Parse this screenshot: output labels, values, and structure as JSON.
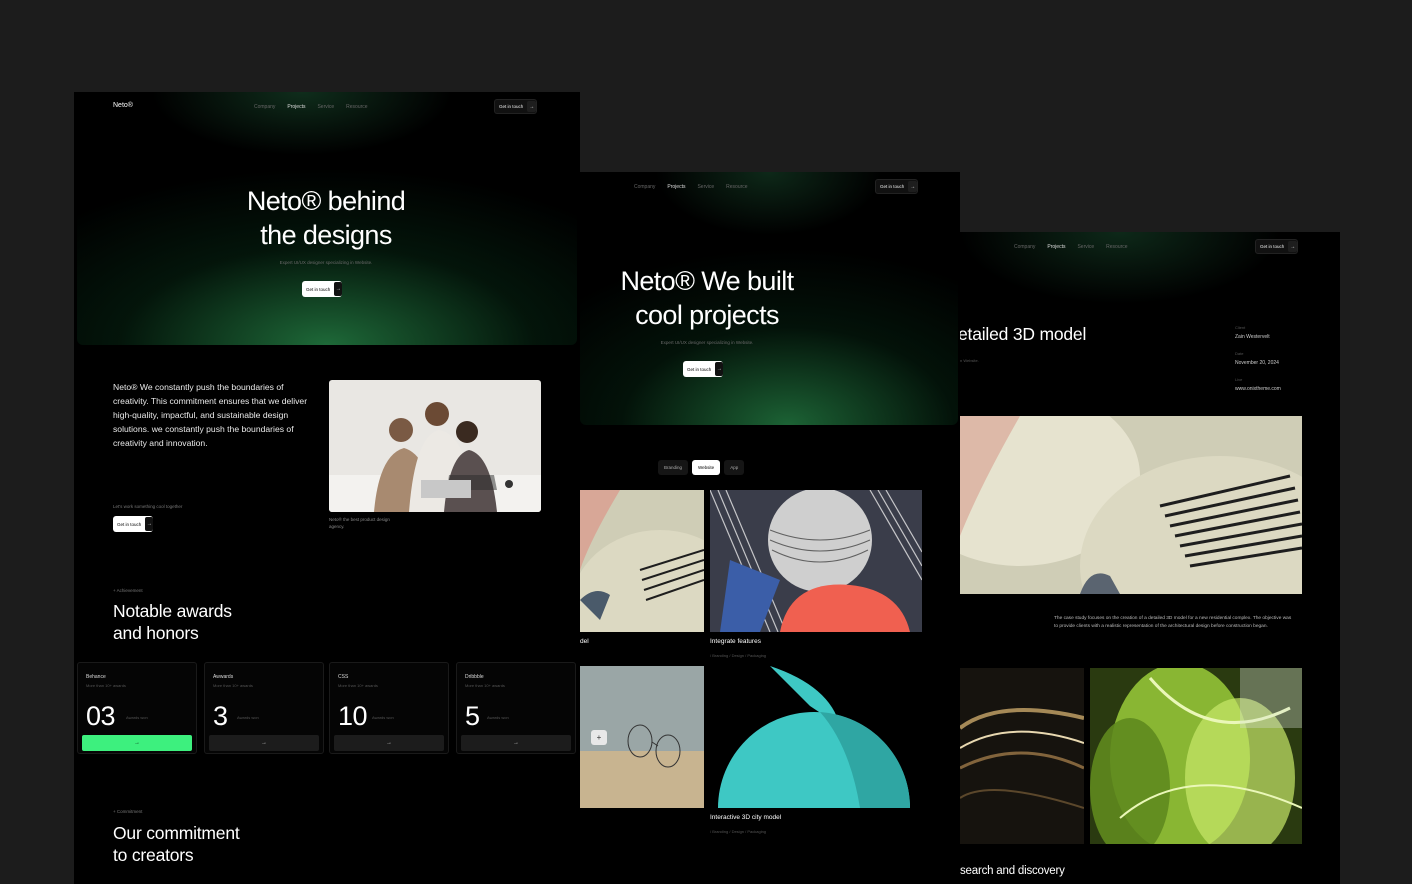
{
  "nav": {
    "company": "Company",
    "projects": "Projects",
    "service": "Service",
    "resource": "Resource",
    "cta": "Get in touch",
    "arrow": "→"
  },
  "panel1": {
    "brand": "Neto®",
    "hero_line1": "Neto® behind",
    "hero_line2": "the designs",
    "hero_sub": "Expert UI/UX designer specializing in Website.",
    "hero_btn": "Get in touch",
    "about": "Neto® We constantly push the boundaries of creativity. This commitment ensures that we deliver high-quality, impactful, and sustainable design solutions. we constantly push the boundaries of creativity and innovation.",
    "lets_work": "Let's work something cool together",
    "about_btn": "Get in touch",
    "photo_caption": "Neto® the best product design agency.",
    "achievement_label": "+ Achievement",
    "awards_title_1": "Notable awards",
    "awards_title_2": "and honors",
    "awards": [
      {
        "name": "Behance",
        "desc": "More than 10+ awards",
        "count": "03",
        "won": "Awards won"
      },
      {
        "name": "Awwards",
        "desc": "More than 10+ awards",
        "count": "3",
        "won": "Awards won"
      },
      {
        "name": "CSS",
        "desc": "More than 10+ awards",
        "count": "10",
        "won": "Awards won"
      },
      {
        "name": "Dribbble",
        "desc": "More than 10+ awards",
        "count": "5",
        "won": "Awards won"
      }
    ],
    "commitment_label": "+ Commitment",
    "commitment_title_1": "Our commitment",
    "commitment_title_2": "to creators"
  },
  "panel2": {
    "hero_line1": "Neto® We built",
    "hero_line2": "cool projects",
    "hero_sub": "Expert UI/UX designer specializing in Website.",
    "hero_btn": "Get in touch",
    "filters": [
      "Branding",
      "Website",
      "App"
    ],
    "projects": [
      {
        "title": "del",
        "tags": ""
      },
      {
        "title": "Integrate features",
        "tags": "/ Branding  / Design / Packaging"
      },
      {
        "title": "Interactive 3D city model",
        "tags": "/ Branding  / Design / Packaging"
      }
    ],
    "plus": "+"
  },
  "panel3": {
    "title": "etailed 3D model",
    "subtitle": "n Website.",
    "client_label": "Client",
    "client": "Zain Westervelt",
    "date_label": "Date",
    "date": "November 20, 2024",
    "live_label": "Live",
    "live": "www.onixtheme.com",
    "body": "The case study focuses on the creation of a detailed 3D model for a new residential complex. The objective was to provide clients with a realistic representation of the architectural design before construction began.",
    "bottom_title": "search and discovery"
  },
  "colors": {
    "background": "#1c1c1c",
    "panel": "#000000",
    "accent_green": "#3df07e"
  }
}
